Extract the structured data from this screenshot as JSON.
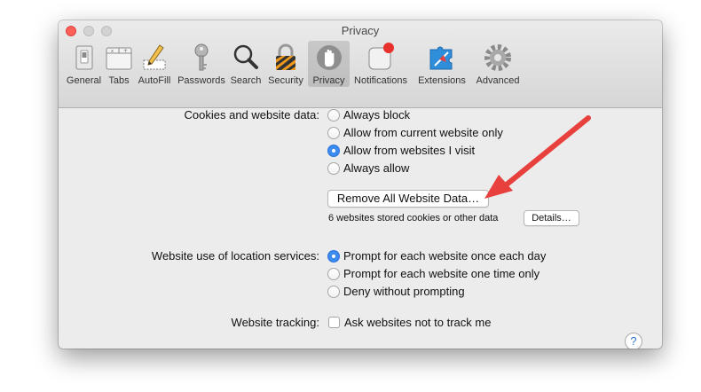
{
  "window": {
    "title": "Privacy"
  },
  "toolbar": {
    "items": [
      {
        "label": "General",
        "icon": "general-switch-icon"
      },
      {
        "label": "Tabs",
        "icon": "tabs-icon"
      },
      {
        "label": "AutoFill",
        "icon": "autofill-pencil-icon"
      },
      {
        "label": "Passwords",
        "icon": "key-icon"
      },
      {
        "label": "Search",
        "icon": "magnifier-icon"
      },
      {
        "label": "Security",
        "icon": "padlock-icon"
      },
      {
        "label": "Privacy",
        "icon": "hand-icon",
        "selected": true
      },
      {
        "label": "Notifications",
        "icon": "notification-badge-icon"
      },
      {
        "label": "Extensions",
        "icon": "puzzle-piece-icon"
      },
      {
        "label": "Advanced",
        "icon": "gear-icon"
      }
    ]
  },
  "cookies": {
    "label": "Cookies and website data:",
    "options": [
      "Always block",
      "Allow from current website only",
      "Allow from websites I visit",
      "Always allow"
    ],
    "selected_index": 2,
    "remove_button": "Remove All Website Data…",
    "stored_text": "6 websites stored cookies or other data",
    "details_button": "Details…"
  },
  "location": {
    "label": "Website use of location services:",
    "options": [
      "Prompt for each website once each day",
      "Prompt for each website one time only",
      "Deny without prompting"
    ],
    "selected_index": 0
  },
  "tracking": {
    "label": "Website tracking:",
    "checkbox_label": "Ask websites not to track me",
    "checked": false
  },
  "help": {
    "label": "?"
  },
  "colors": {
    "accent": "#3d8bf0",
    "arrow": "#e8413d",
    "close": "#fc5f57"
  }
}
